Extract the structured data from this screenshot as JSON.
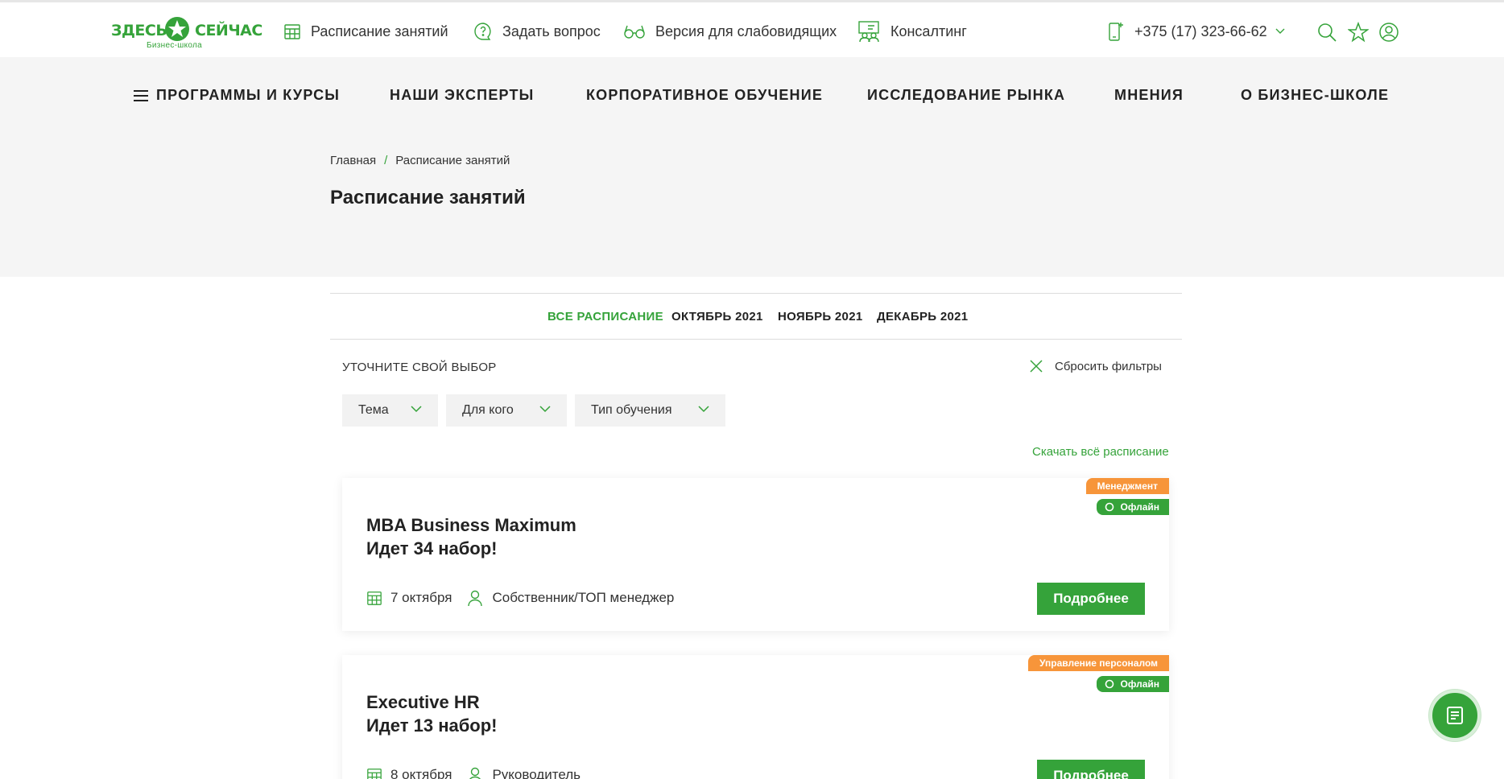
{
  "brand": {
    "word1": "ЗДЕСЬ",
    "word2": "СЕЙЧАС",
    "subtitle": "Бизнес-школа",
    "color": "#35a33a"
  },
  "topbar": {
    "links": [
      {
        "label": "Расписание занятий",
        "icon": "calendar-icon"
      },
      {
        "label": "Задать вопрос",
        "icon": "question-chat-icon"
      },
      {
        "label": "Версия для слабовидящих",
        "icon": "glasses-icon"
      },
      {
        "label": "Консалтинг",
        "icon": "consulting-icon"
      }
    ],
    "phone": "+375 (17) 323-66-62",
    "icons": [
      "search-icon",
      "star-icon",
      "user-icon"
    ]
  },
  "nav": {
    "items": [
      "Программы и курсы",
      "Наши эксперты",
      "Корпоративное обучение",
      "Исследование рынка",
      "Мнения",
      "О бизнес-школе"
    ]
  },
  "breadcrumb": {
    "home": "Главная",
    "separator": "/",
    "current": "Расписание занятий"
  },
  "page": {
    "title": "Расписание занятий"
  },
  "tabs": [
    {
      "label": "Все расписание",
      "active": true
    },
    {
      "label": "Октябрь 2021",
      "active": false
    },
    {
      "label": "Ноябрь 2021",
      "active": false
    },
    {
      "label": "Декабрь 2021",
      "active": false
    }
  ],
  "filters": {
    "heading": "Уточните свой выбор",
    "reset": "Сбросить фильтры",
    "dropdowns": [
      "Тема",
      "Для кого",
      "Тип обучения"
    ],
    "download": "Скачать всё расписание"
  },
  "cards": [
    {
      "category": "Менеджмент",
      "format": "Офлайн",
      "title_line1": "MBA Business Maximum",
      "title_line2": "Идет 34 набор!",
      "date": "7 октября",
      "audience": "Собственник/ТОП менеджер",
      "button": "Подробнее"
    },
    {
      "category": "Управление персоналом",
      "format": "Офлайн",
      "title_line1": "Executive HR",
      "title_line2": "Идет 13 набор!",
      "date": "8 октября",
      "audience": "Руководитель",
      "button": "Подробнее"
    }
  ],
  "colors": {
    "accent": "#35a33a",
    "category_badge": "#f7953a"
  }
}
